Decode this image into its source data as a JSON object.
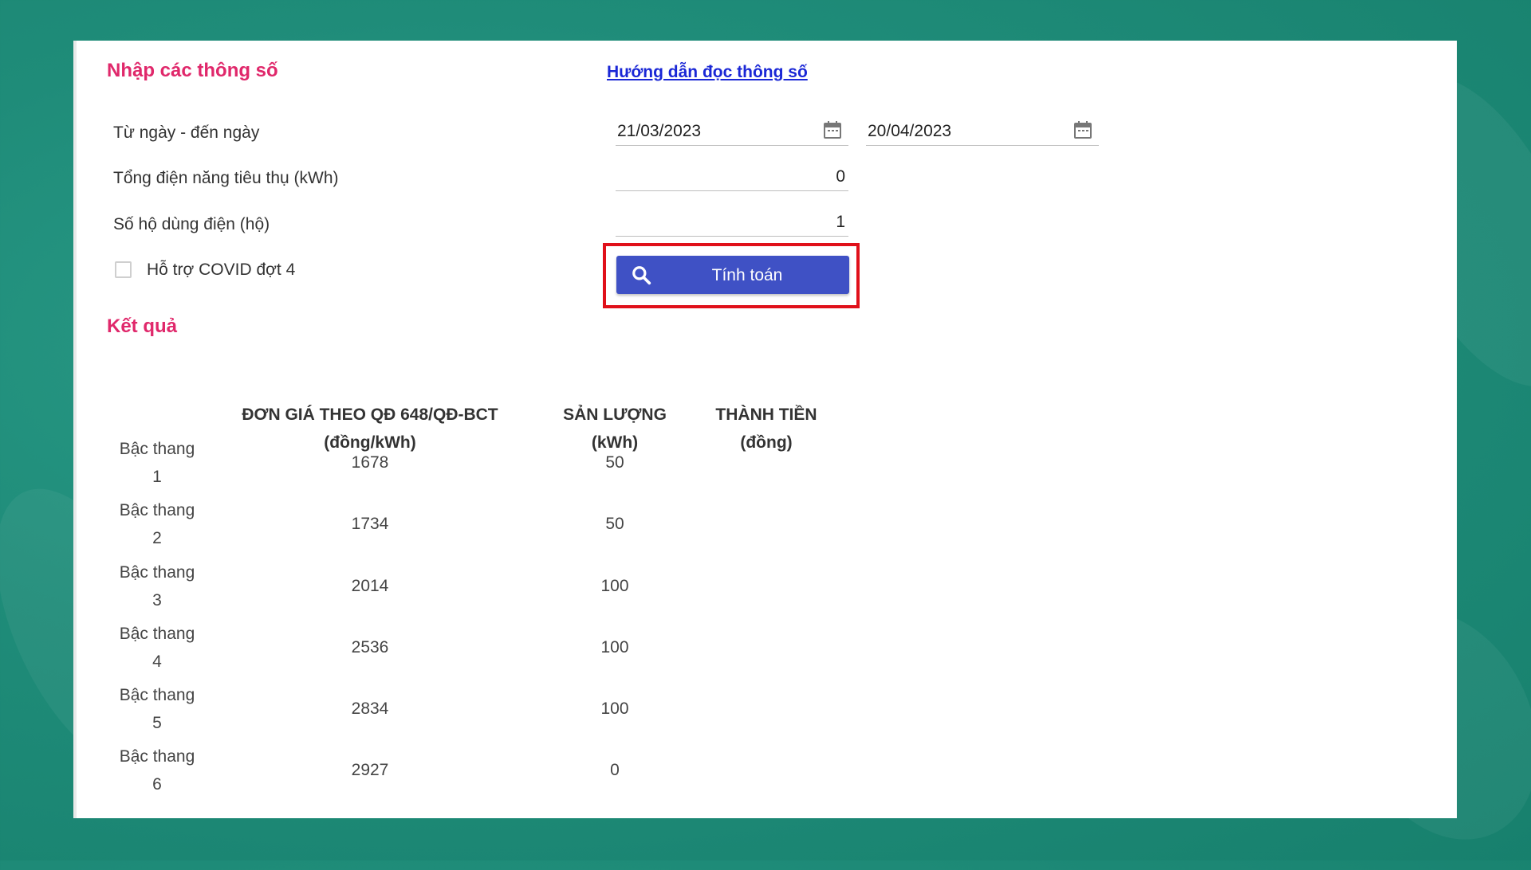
{
  "form": {
    "title": "Nhập các thông số",
    "help_link": "Hướng dẫn đọc thông số",
    "date_label": "Từ ngày - đến ngày",
    "from_date": "21/03/2023",
    "to_date": "20/04/2023",
    "energy_label": "Tổng điện năng tiêu thụ (kWh)",
    "energy_value": "0",
    "households_label": "Số hộ dùng điện (hộ)",
    "households_value": "1",
    "covid_label": "Hỗ trợ COVID đợt 4",
    "covid_checked": false,
    "calc_button": "Tính toán",
    "calc_icon": "search-icon"
  },
  "result": {
    "title": "Kết quả",
    "headers": {
      "price_line1": "ĐƠN GIÁ THEO QĐ 648/QĐ-BCT",
      "price_line2": "(đồng/kWh)",
      "qty_line1": "SẢN LƯỢNG",
      "qty_line2": "(kWh)",
      "amount_line1": "THÀNH TIỀN",
      "amount_line2": "(đồng)"
    },
    "rows": [
      {
        "tier_label": "Bậc thang",
        "tier_no": "1",
        "price": "1678",
        "qty": "50",
        "amount": ""
      },
      {
        "tier_label": "Bậc thang",
        "tier_no": "2",
        "price": "1734",
        "qty": "50",
        "amount": ""
      },
      {
        "tier_label": "Bậc thang",
        "tier_no": "3",
        "price": "2014",
        "qty": "100",
        "amount": ""
      },
      {
        "tier_label": "Bậc thang",
        "tier_no": "4",
        "price": "2536",
        "qty": "100",
        "amount": ""
      },
      {
        "tier_label": "Bậc thang",
        "tier_no": "5",
        "price": "2834",
        "qty": "100",
        "amount": ""
      },
      {
        "tier_label": "Bậc thang",
        "tier_no": "6",
        "price": "2927",
        "qty": "0",
        "amount": ""
      }
    ]
  },
  "colors": {
    "accent": "#e0286b",
    "link": "#1a27d6",
    "button": "#3f51c5",
    "highlight": "#e0101a",
    "background": "#1f8c79"
  }
}
